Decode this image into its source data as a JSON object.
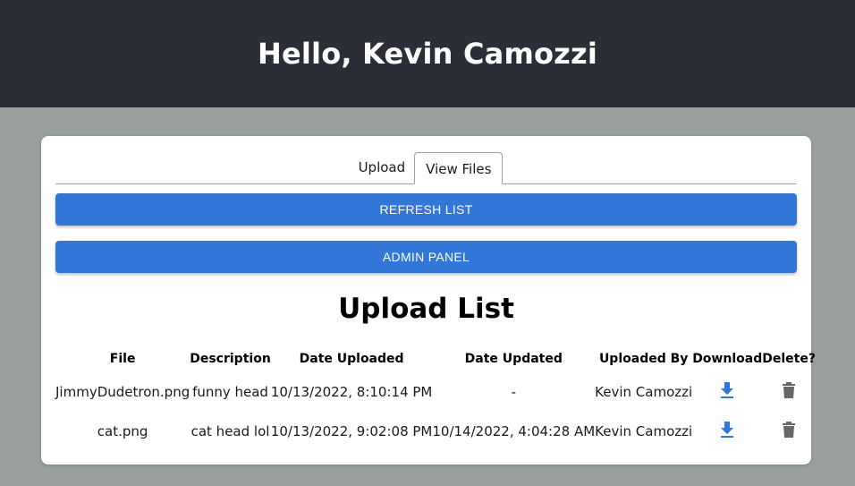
{
  "header": {
    "greeting": "Hello, Kevin Camozzi"
  },
  "tabs": [
    {
      "label": "Upload",
      "active": false
    },
    {
      "label": "View Files",
      "active": true
    }
  ],
  "buttons": {
    "refresh": "REFRESH LIST",
    "admin": "ADMIN PANEL"
  },
  "upload_list": {
    "title": "Upload List",
    "columns": [
      "File",
      "Description",
      "Date Uploaded",
      "Date Updated",
      "Uploaded By",
      "Download",
      "Delete?"
    ],
    "rows": [
      {
        "file": "JimmyDudetron.png",
        "description": "funny head",
        "uploaded": "10/13/2022, 8:10:14 PM",
        "updated": "-",
        "by": "Kevin Camozzi",
        "download_icon": "download-icon",
        "delete_icon": "trash-icon"
      },
      {
        "file": "cat.png",
        "description": "cat head lol",
        "uploaded": "10/13/2022, 9:02:08 PM",
        "updated": "10/14/2022, 4:04:28 AM",
        "by": "Kevin Camozzi",
        "download_icon": "download-icon",
        "delete_icon": "trash-icon"
      }
    ]
  },
  "colors": {
    "header_bg": "#2b2e37",
    "page_bg": "#999e9e",
    "button": "#3276d8",
    "download_icon": "#3276d8",
    "trash_icon": "#666666"
  }
}
